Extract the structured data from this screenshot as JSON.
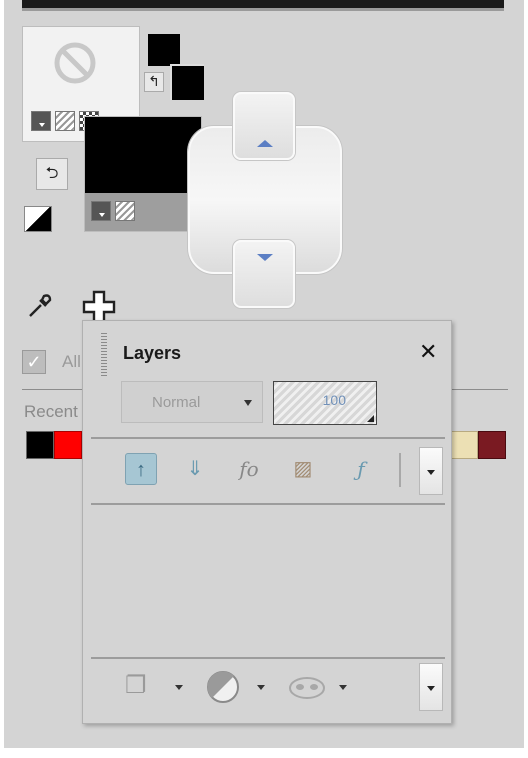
{
  "layers_panel": {
    "title": "Layers",
    "close_glyph": "✕",
    "blend_mode": "Normal",
    "opacity": "100"
  },
  "materials": {
    "all_label": "All",
    "recent_label": "Recent",
    "recent_colors": [
      "#000000",
      "#ff0000",
      "#ece0b4",
      "#7a1a22"
    ]
  },
  "colors": {
    "stepper_arrow": "#5c7fc4",
    "panel_bg": "#d4d4d4",
    "selected_layer_button": "#a6c6d3"
  },
  "icons": [
    "no-texture-icon",
    "swap-colors-icon",
    "dropper-icon",
    "crosshair-icon",
    "close-icon",
    "layer-up-icon",
    "layer-down-icon",
    "fx-icon",
    "paint-layer-icon",
    "fx-layer-icon",
    "new-layer-icon",
    "adjustment-layer-icon",
    "mask-icon"
  ]
}
